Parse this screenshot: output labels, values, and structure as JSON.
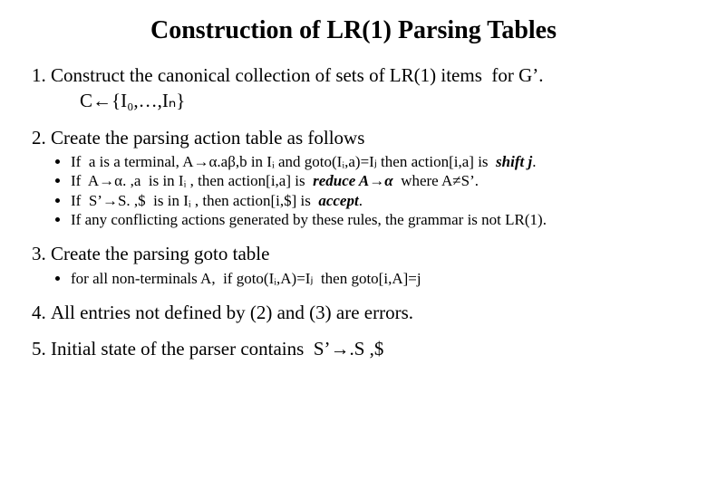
{
  "title": "Construction of LR(1) Parsing Tables",
  "items": {
    "i1": {
      "text": "Construct the canonical collection of sets of LR(1) items  for G’.",
      "sub": "C←{I₀,…,Iₙ}"
    },
    "i2": {
      "text": "Create the parsing action table as follows",
      "b1": "If  a is a terminal, A→α.aβ,b in Iᵢ and goto(Iᵢ,a)=Iⱼ then action[i,a] is  shift j.",
      "b2": "If  A→α. ,a  is in Iᵢ , then action[i,a] is  reduce A→α  where A≠S’.",
      "b3": "If  S’→S. ,$  is in Iᵢ , then action[i,$] is  accept.",
      "b4": "If any conflicting actions generated by these rules, the grammar is not LR(1)."
    },
    "i3": {
      "text": "Create the parsing goto table",
      "b1": "for all non-terminals A,  if goto(Iᵢ,A)=Iⱼ  then goto[i,A]=j"
    },
    "i4": {
      "text": "All entries not defined by (2) and (3) are errors."
    },
    "i5": {
      "text": "Initial state of the parser contains  S’→.S ,$"
    }
  }
}
